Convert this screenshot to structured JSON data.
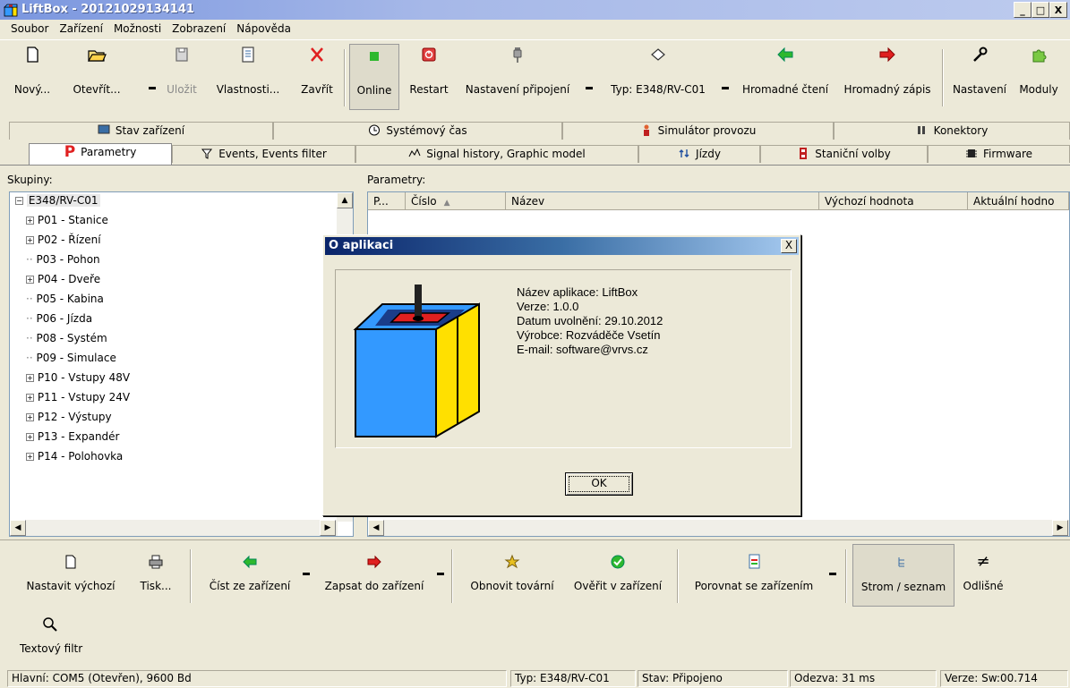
{
  "window": {
    "title": "LiftBox - 20121029134141",
    "minimize": "_",
    "maximize": "□",
    "close": "X"
  },
  "menu": [
    "Soubor",
    "Zařízení",
    "Možnosti",
    "Zobrazení",
    "Nápověda"
  ],
  "toolbar": {
    "new": "Nový...",
    "open": "Otevřít...",
    "save": "Uložit",
    "properties": "Vlastnosti...",
    "close": "Zavřít",
    "online": "Online",
    "restart": "Restart",
    "connection": "Nastavení připojení",
    "type": "Typ: E348/RV-C01",
    "bulk_read": "Hromadné čtení",
    "bulk_write": "Hromadný zápis",
    "settings": "Nastavení",
    "modules": "Moduly"
  },
  "tabs_row1": [
    "Stav zařízení",
    "Systémový čas",
    "Simulátor provozu",
    "Konektory"
  ],
  "tabs_row2": [
    "Parametry",
    "Events, Events filter",
    "Signal history, Graphic model",
    "Jízdy",
    "Staniční volby",
    "Firmware"
  ],
  "groups": {
    "label": "Skupiny:",
    "root": "E348/RV-C01",
    "items": [
      {
        "label": "P01 - Stanice",
        "expandable": true
      },
      {
        "label": "P02 - Řízení",
        "expandable": true
      },
      {
        "label": "P03 - Pohon",
        "expandable": false
      },
      {
        "label": "P04 - Dveře",
        "expandable": true
      },
      {
        "label": "P05 - Kabina",
        "expandable": false
      },
      {
        "label": "P06 - Jízda",
        "expandable": false
      },
      {
        "label": "P08 - Systém",
        "expandable": false
      },
      {
        "label": "P09 - Simulace",
        "expandable": false
      },
      {
        "label": "P10 - Vstupy 48V",
        "expandable": true
      },
      {
        "label": "P11 - Vstupy 24V",
        "expandable": true
      },
      {
        "label": "P12 - Výstupy",
        "expandable": true
      },
      {
        "label": "P13 - Expandér",
        "expandable": true
      },
      {
        "label": "P14 - Polohovka",
        "expandable": true
      }
    ]
  },
  "params": {
    "label": "Parametry:",
    "columns": [
      "P...",
      "Číslo",
      "Název",
      "Výchozí hodnota",
      "Aktuální hodno"
    ]
  },
  "bottom_toolbar": {
    "set_default": "Nastavit výchozí",
    "print": "Tisk...",
    "read": "Číst ze zařízení",
    "write": "Zapsat do zařízení",
    "restore": "Obnovit tovární",
    "verify": "Ověřit v zařízení",
    "compare": "Porovnat se zařízením",
    "tree_list": "Strom / seznam",
    "diff": "Odlišné",
    "text_filter": "Textový filtr"
  },
  "status": {
    "main": "Hlavní: COM5 (Otevřen), 9600 Bd",
    "type": "Typ: E348/RV-C01",
    "state": "Stav: Připojeno",
    "latency": "Odezva: 31 ms",
    "version": "Verze: Sw:00.714"
  },
  "dialog": {
    "title": "O aplikaci",
    "close": "X",
    "app_name": "Název aplikace: LiftBox",
    "version": "Verze: 1.0.0",
    "release": "Datum uvolnění: 29.10.2012",
    "vendor": "Výrobce: Rozváděče Vsetín",
    "email": "E-mail: software@vrvs.cz",
    "ok": "OK"
  },
  "colors": {
    "accent_green": "#2eb82e",
    "accent_red": "#e02020",
    "logo_blue": "#3399ff",
    "logo_yellow": "#ffe000"
  }
}
